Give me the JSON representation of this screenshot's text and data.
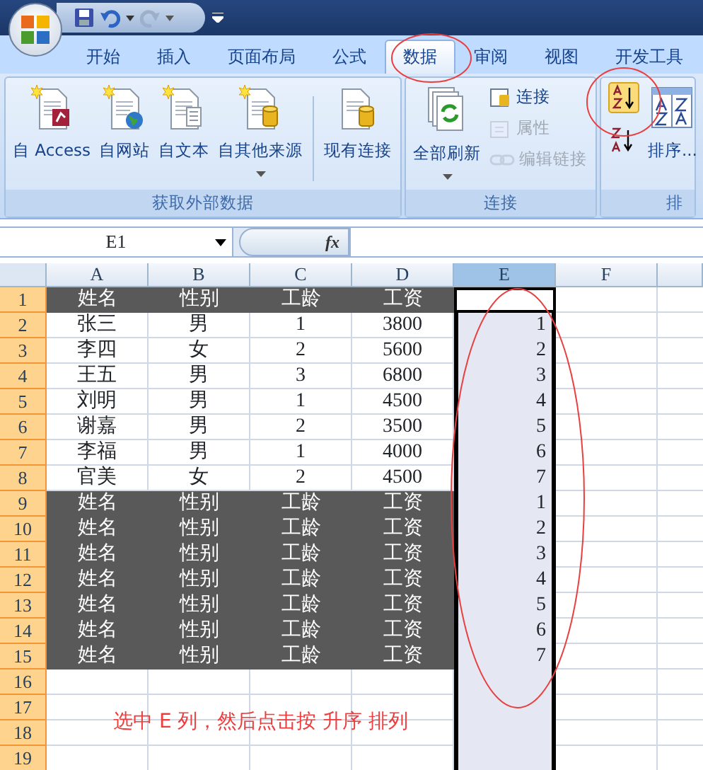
{
  "tabs": [
    {
      "label": "开始",
      "selected": false
    },
    {
      "label": "插入",
      "selected": false
    },
    {
      "label": "页面布局",
      "selected": false
    },
    {
      "label": "公式",
      "selected": false
    },
    {
      "label": "数据",
      "selected": true
    },
    {
      "label": "审阅",
      "selected": false
    },
    {
      "label": "视图",
      "selected": false
    },
    {
      "label": "开发工具",
      "selected": false
    }
  ],
  "ribbon_groups": [
    {
      "label": "获取外部数据",
      "buttons": [
        {
          "label": "自 Access",
          "kind": "access",
          "disabled": false
        },
        {
          "label": "自网站",
          "kind": "web",
          "disabled": false
        },
        {
          "label": "自文本",
          "kind": "text",
          "disabled": false
        },
        {
          "label": "自其他来源",
          "kind": "other",
          "disabled": false
        },
        {
          "label": "现有连接",
          "kind": "existing",
          "disabled": false
        }
      ]
    },
    {
      "label": "连接",
      "buttons": [
        {
          "label": "全部刷新",
          "kind": "refresh",
          "disabled": false
        },
        {
          "label": "连接",
          "kind": "connections",
          "disabled": false
        },
        {
          "label": "属性",
          "kind": "properties",
          "disabled": true
        },
        {
          "label": "编辑链接",
          "kind": "links",
          "disabled": true
        }
      ]
    },
    {
      "label": "排",
      "buttons": [
        {
          "kind": "sort_asc",
          "disabled": false
        },
        {
          "kind": "sort_desc",
          "disabled": false
        },
        {
          "label": "排序...",
          "kind": "sort",
          "disabled": false
        }
      ]
    }
  ],
  "name_box": "E1",
  "formula_label": "fx",
  "columns": [
    {
      "label": "A",
      "selected": false
    },
    {
      "label": "B",
      "selected": false
    },
    {
      "label": "C",
      "selected": false
    },
    {
      "label": "D",
      "selected": false
    },
    {
      "label": "E",
      "selected": true
    },
    {
      "label": "F",
      "selected": false
    }
  ],
  "rows": [
    {
      "number": "1",
      "kind": "header",
      "cells": [
        "姓名",
        "性别",
        "工龄",
        "工资"
      ]
    },
    {
      "number": "2",
      "kind": "data",
      "cells": [
        "张三",
        "男",
        "1",
        "3800"
      ],
      "column_e": "1"
    },
    {
      "number": "3",
      "kind": "data",
      "cells": [
        "李四",
        "女",
        "2",
        "5600"
      ],
      "column_e": "2"
    },
    {
      "number": "4",
      "kind": "data",
      "cells": [
        "王五",
        "男",
        "3",
        "6800"
      ],
      "column_e": "3"
    },
    {
      "number": "5",
      "kind": "data",
      "cells": [
        "刘明",
        "男",
        "1",
        "4500"
      ],
      "column_e": "4"
    },
    {
      "number": "6",
      "kind": "data",
      "cells": [
        "谢嘉",
        "男",
        "2",
        "3500"
      ],
      "column_e": "5"
    },
    {
      "number": "7",
      "kind": "data",
      "cells": [
        "李福",
        "男",
        "1",
        "4000"
      ],
      "column_e": "6"
    },
    {
      "number": "8",
      "kind": "data",
      "cells": [
        "官美",
        "女",
        "2",
        "4500"
      ],
      "column_e": "7"
    },
    {
      "number": "9",
      "kind": "header",
      "cells": [
        "姓名",
        "性别",
        "工龄",
        "工资"
      ],
      "column_e": "1"
    },
    {
      "number": "10",
      "kind": "header",
      "cells": [
        "姓名",
        "性别",
        "工龄",
        "工资"
      ],
      "column_e": "2"
    },
    {
      "number": "11",
      "kind": "header",
      "cells": [
        "姓名",
        "性别",
        "工龄",
        "工资"
      ],
      "column_e": "3"
    },
    {
      "number": "12",
      "kind": "header",
      "cells": [
        "姓名",
        "性别",
        "工龄",
        "工资"
      ],
      "column_e": "4"
    },
    {
      "number": "13",
      "kind": "header",
      "cells": [
        "姓名",
        "性别",
        "工龄",
        "工资"
      ],
      "column_e": "5"
    },
    {
      "number": "14",
      "kind": "header",
      "cells": [
        "姓名",
        "性别",
        "工龄",
        "工资"
      ],
      "column_e": "6"
    },
    {
      "number": "15",
      "kind": "header",
      "cells": [
        "姓名",
        "性别",
        "工龄",
        "工资"
      ],
      "column_e": "7"
    },
    {
      "number": "16",
      "kind": "empty"
    },
    {
      "number": "17",
      "kind": "empty"
    },
    {
      "number": "18",
      "kind": "empty"
    },
    {
      "number": "19",
      "kind": "empty"
    }
  ],
  "annotation": "选中 E 列，然后点击按 升序 排列"
}
